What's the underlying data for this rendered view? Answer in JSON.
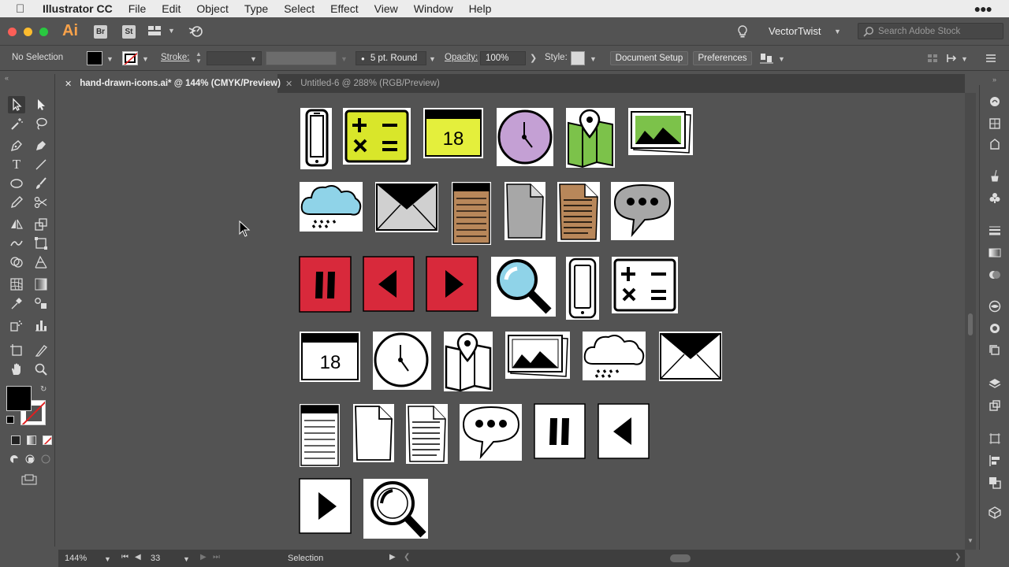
{
  "menubar": {
    "app_name": "Illustrator CC",
    "items": [
      "File",
      "Edit",
      "Object",
      "Type",
      "Select",
      "Effect",
      "View",
      "Window",
      "Help"
    ]
  },
  "appbar": {
    "logo": "Ai",
    "bridge": "Br",
    "stock": "St",
    "workspace": "VectorTwist",
    "search_placeholder": "Search Adobe Stock"
  },
  "control": {
    "selection": "No Selection",
    "stroke_label": "Stroke:",
    "brush": "5 pt. Round",
    "opacity_label": "Opacity:",
    "opacity_value": "100%",
    "style_label": "Style:",
    "doc_setup": "Document Setup",
    "preferences": "Preferences"
  },
  "tabs": [
    {
      "label": "hand-drawn-icons.ai* @ 144% (CMYK/Preview)",
      "active": true
    },
    {
      "label": "Untitled-6 @ 288% (RGB/Preview)",
      "active": false
    }
  ],
  "status": {
    "zoom": "144%",
    "page": "33",
    "tool": "Selection"
  },
  "colors": {
    "icon_yellow": "#d9e62a",
    "icon_red": "#d8293b",
    "icon_purple": "#c4a0d4",
    "icon_blue": "#8fd3e8",
    "icon_green": "#7cc24a",
    "icon_tan": "#b8875a",
    "icon_gray": "#a7a7a7"
  }
}
